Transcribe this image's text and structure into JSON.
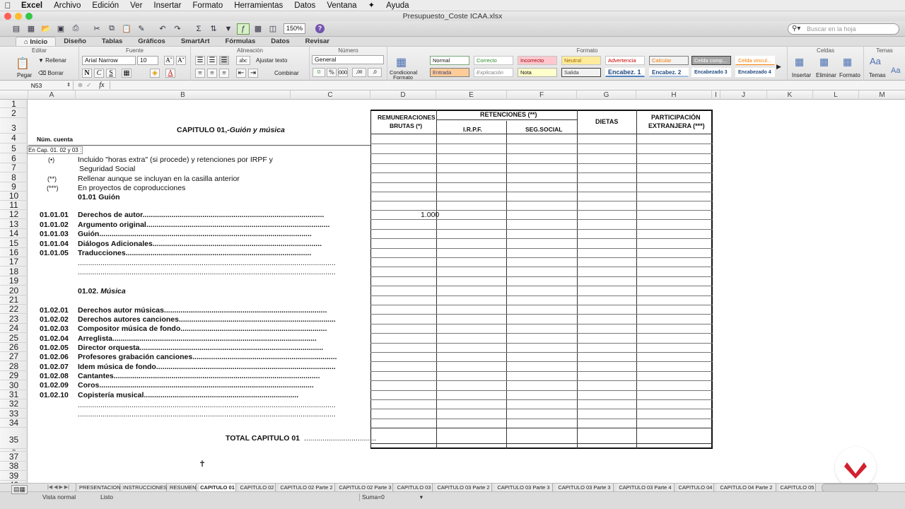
{
  "menubar": {
    "app": "Excel",
    "items": [
      "Archivo",
      "Edición",
      "Ver",
      "Insertar",
      "Formato",
      "Herramientas",
      "Datos",
      "Ventana",
      "Ayuda"
    ]
  },
  "window": {
    "title": "Presupuesto_Coste ICAA.xlsx"
  },
  "toolbar": {
    "zoom": "150%",
    "search_placeholder": "Buscar en la hoja"
  },
  "ribbon": {
    "tabs": [
      "Inicio",
      "Diseño",
      "Tablas",
      "Gráficos",
      "SmartArt",
      "Fórmulas",
      "Datos",
      "Revisar"
    ],
    "groups": {
      "edit": "Editar",
      "font": "Fuente",
      "align": "Alineación",
      "number": "Número",
      "format": "Formato",
      "cells": "Celdas",
      "themes": "Temas"
    },
    "paste": "Pegar",
    "fill": "Rellenar",
    "clear": "Borrar",
    "font_name": "Arial Narrow",
    "font_size": "10",
    "wrap": "Ajustar texto",
    "merge": "Combinar",
    "number_format": "General",
    "conditional": "Condicional",
    "conditional2": "Formato",
    "styles": [
      "Normal",
      "Correcto",
      "Incorrecto",
      "Neutral",
      "Advertencia",
      "Calcular",
      "Celda comp...",
      "Celda vincul...",
      "Entrada",
      "Explicación",
      "Nota",
      "Salida",
      "Encabez. 1",
      "Encabez. 2",
      "Encabezado 3",
      "Encabezado 4"
    ],
    "insert": "Insertar",
    "delete": "Eliminar",
    "format_cells": "Formato",
    "themes_btn": "Temas"
  },
  "formula_bar": {
    "name_box": "N53",
    "fx": "fx",
    "content": ""
  },
  "columns": [
    "A",
    "B",
    "C",
    "D",
    "E",
    "F",
    "G",
    "H",
    "I",
    "J",
    "K",
    "L",
    "M"
  ],
  "rows": [
    "1",
    "2",
    "3",
    "4",
    "5",
    "6",
    "7",
    "8",
    "9",
    "10",
    "11",
    "12",
    "13",
    "14",
    "15",
    "16",
    "17",
    "18",
    "19",
    "20",
    "21",
    "22",
    "23",
    "24",
    "25",
    "26",
    "27",
    "28",
    "29",
    "30",
    "31",
    "32",
    "33",
    "34",
    "35",
    "36",
    "37",
    "38",
    "39",
    "40"
  ],
  "sheet": {
    "title_prefix": "CAPITULO 01,-",
    "title_italic": "Guión y música",
    "num_cuenta": "Núm. cuenta",
    "a5": "En Cap. 01. 02 y 03 :",
    "notes": [
      {
        "mark": "(•)",
        "text": "Incluido \"horas extra\" (si procede) y retenciones por IRPF y"
      },
      {
        "mark": "",
        "text": "Seguridad Social"
      },
      {
        "mark": "(**)",
        "text": "Rellenar aunque se incluyan en la casilla anterior"
      },
      {
        "mark": "(***)",
        "text": "En proyectos de coproducciones"
      }
    ],
    "sec1": "01.01 Guión",
    "sec2_num": "01.02.",
    "sec2_name": "Música",
    "items1": [
      {
        "code": "01.01.01",
        "label": "Derechos de autor",
        "d": "1.000"
      },
      {
        "code": "01.01.02",
        "label": "Argumento original",
        "d": ""
      },
      {
        "code": "01.01.03",
        "label": "Guión",
        "d": ""
      },
      {
        "code": "01.01.04",
        "label": "Diálogos Adicionales",
        "d": ""
      },
      {
        "code": "01.01.05",
        "label": "Traducciones",
        "d": ""
      }
    ],
    "items2": [
      {
        "code": "01.02.01",
        "label": "Derechos autor músicas"
      },
      {
        "code": "01.02.02",
        "label": "Derechos autores  canciones"
      },
      {
        "code": "01.02.03",
        "label": "Compositor música de fondo"
      },
      {
        "code": "01.02.04",
        "label": "Arreglista"
      },
      {
        "code": "01.02.05",
        "label": "Director orquesta"
      },
      {
        "code": "01.02.06",
        "label": "Profesores grabación canciones"
      },
      {
        "code": "01.02.07",
        "label": "Idem música de fondo"
      },
      {
        "code": "01.02.08",
        "label": "Cantantes"
      },
      {
        "code": "01.02.09",
        "label": "Coros"
      },
      {
        "code": "01.02.10",
        "label": "Copistería musical"
      }
    ],
    "headers": {
      "remun1": "REMUNERACIONES",
      "remun2": "BRUTAS (*)",
      "ret": "RETENCIONES (**)",
      "irpf": "I.R.P.F.",
      "ss": "SEG.SOCIAL",
      "dietas": "DIETAS",
      "part1": "PARTICIPACIÓN",
      "part2": "EXTRANJERA (***)"
    },
    "total": "TOTAL CAPITULO 01"
  },
  "sheet_tabs": [
    "PRESENTACION",
    "INSTRUCCIONES",
    "RESUMEN",
    "CAPITULO 01",
    "CAPITULO 02",
    "CAPITULO 02 Parte 2",
    "CAPITULO 02 Parte 3",
    "CAPITULO 03",
    "CAPITULO 03  Parte 2",
    "CAPITULO 03  Parte 3",
    "CAPITULO 03  Parte 3",
    "CAPITULO 03  Parte 4",
    "CAPITULO 04",
    "CAPITULO 04  Parte 2",
    "CAPITULO 05"
  ],
  "status": {
    "view": "Vista normal",
    "ready": "Listo",
    "sum": "Suma=0"
  }
}
